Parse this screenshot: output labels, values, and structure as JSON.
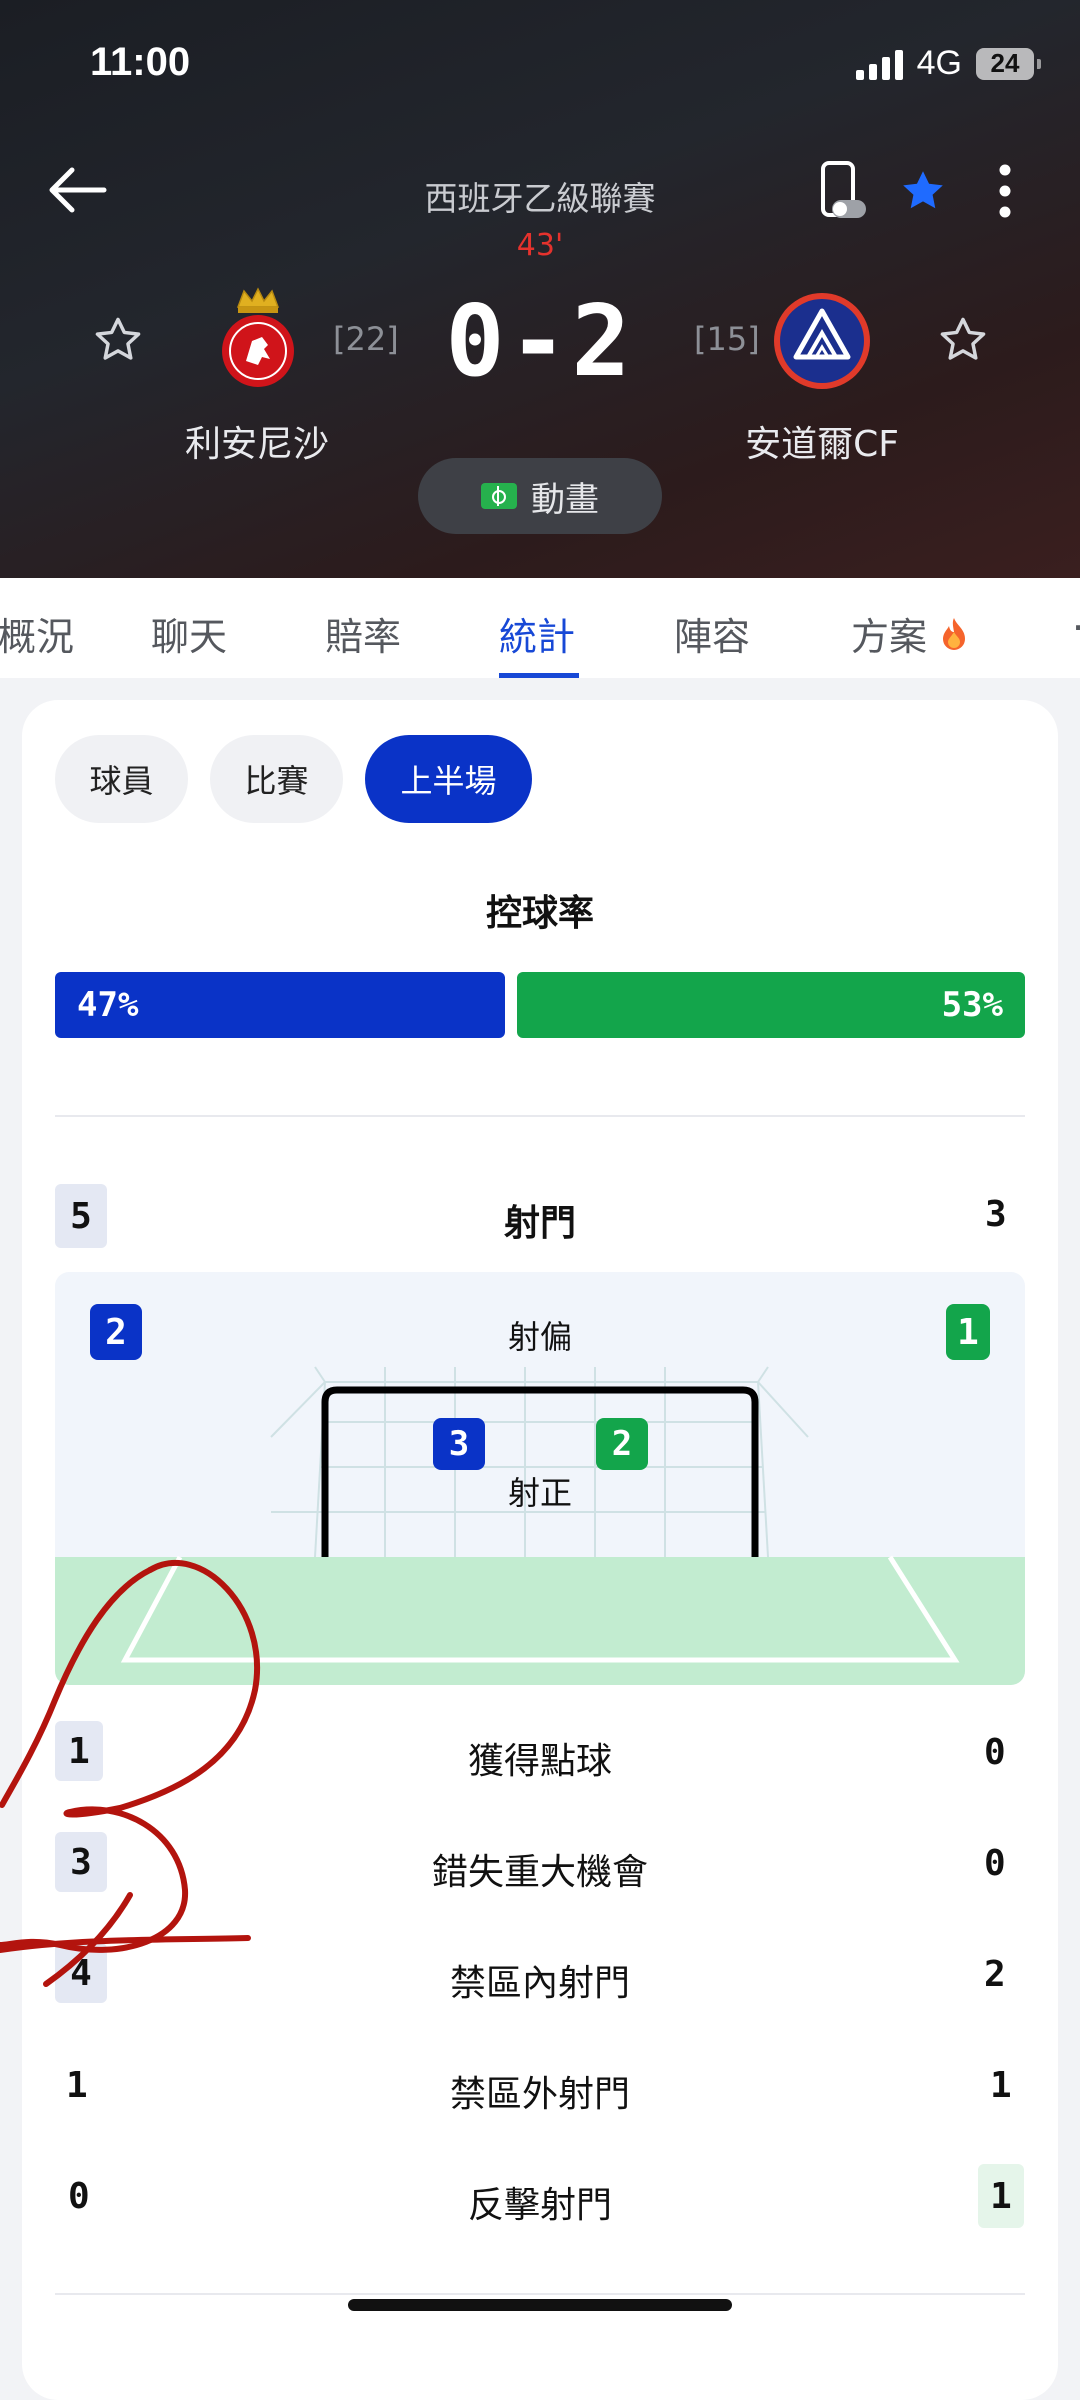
{
  "status_bar": {
    "time": "11:00",
    "network": "4G",
    "battery": "24"
  },
  "match": {
    "league": "西班牙乙級聯賽",
    "minute": "43'",
    "score": "0-2",
    "home": {
      "name": "利安尼沙",
      "rank": "[22]"
    },
    "away": {
      "name": "安道爾CF",
      "rank": "[15]"
    },
    "animation_label": "動畫"
  },
  "tabs": [
    "概況",
    "聊天",
    "賠率",
    "統計",
    "陣容",
    "方案"
  ],
  "active_tab": "統計",
  "filters": [
    "球員",
    "比賽",
    "上半場"
  ],
  "active_filter": "上半場",
  "possession": {
    "title": "控球率",
    "home": "47%",
    "away": "53%",
    "home_value": 47,
    "away_value": 53
  },
  "shots": {
    "label": "射門",
    "home": "5",
    "away": "3",
    "off_target": {
      "label": "射偏",
      "home": "2",
      "away": "1"
    },
    "on_target": {
      "label": "射正",
      "home": "3",
      "away": "2"
    }
  },
  "stats": [
    {
      "label": "獲得點球",
      "home": "1",
      "away": "0"
    },
    {
      "label": "錯失重大機會",
      "home": "3",
      "away": "0"
    },
    {
      "label": "禁區內射門",
      "home": "4",
      "away": "2"
    },
    {
      "label": "禁區外射門",
      "home": "1",
      "away": "1"
    },
    {
      "label": "反擊射門",
      "home": "0",
      "away": "1"
    }
  ],
  "colors": {
    "home": "#0a33c7",
    "away": "#13a54b",
    "accent": "#1748d6",
    "live_minute": "#e5322d",
    "annotation": "#b3140e"
  }
}
